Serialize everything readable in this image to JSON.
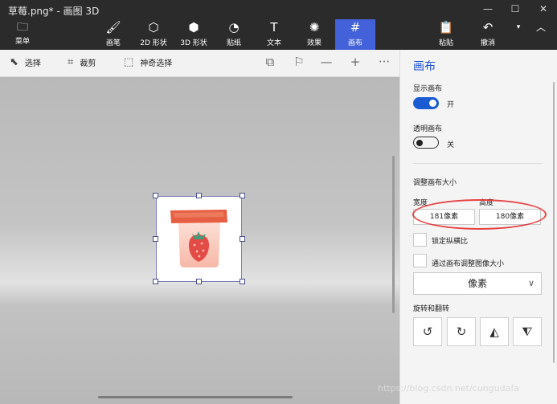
{
  "window": {
    "title": "草莓.png* - 画图 3D",
    "controls": [
      "—",
      "☐",
      "✕"
    ]
  },
  "ribbon": {
    "menu_label": "菜单",
    "tools": [
      {
        "label": "画笔",
        "icon": "brush-icon"
      },
      {
        "label": "2D 形状",
        "icon": "shapes-2d-icon"
      },
      {
        "label": "3D 形状",
        "icon": "shapes-3d-icon"
      },
      {
        "label": "贴纸",
        "icon": "sticker-icon"
      },
      {
        "label": "文本",
        "icon": "text-icon"
      },
      {
        "label": "效果",
        "icon": "effects-icon"
      },
      {
        "label": "画布",
        "icon": "canvas-icon"
      }
    ],
    "active_tool": "画布",
    "paste_label": "粘贴",
    "undo_label": "撤消"
  },
  "subtoolbar": {
    "select_label": "选择",
    "crop_label": "裁剪",
    "magic_select_label": "神奇选择",
    "more": "···"
  },
  "panel": {
    "title": "画布",
    "show_canvas_label": "显示画布",
    "show_canvas_state": "开",
    "transparent_canvas_label": "透明画布",
    "transparent_canvas_state": "关",
    "resize_label": "调整画布大小",
    "width_label": "宽度",
    "height_label": "高度",
    "width_value": "181像素",
    "height_value": "180像素",
    "lock_aspect_label": "锁定纵横比",
    "resize_image_label": "通过画布调整图像大小",
    "unit_value": "像素",
    "rotate_flip_label": "旋转和翻转"
  },
  "watermark": "https://blog.csdn.net/cungudafa",
  "colors": {
    "ribbon_bg": "#2b2b2b",
    "active_tool": "#4361d8",
    "accent": "#1a5bd1",
    "annotation": "#e84242"
  }
}
